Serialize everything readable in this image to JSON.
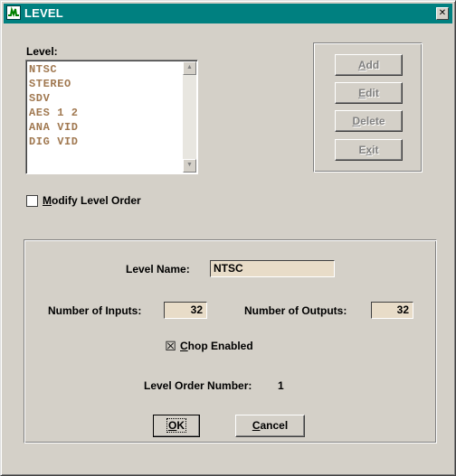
{
  "window": {
    "title": "LEVEL",
    "close_glyph": "✕",
    "app_icon": "level-app-icon"
  },
  "level_list": {
    "label": "Level:",
    "items": [
      "NTSC",
      "STEREO",
      "SDV",
      "AES 1 2",
      "ANA VID",
      "DIG VID"
    ],
    "scroll_up_glyph": "▲",
    "scroll_down_glyph": "▼"
  },
  "actions": {
    "add": {
      "first": "",
      "ul": "A",
      "rest": "dd"
    },
    "edit": {
      "first": "",
      "ul": "E",
      "rest": "dit"
    },
    "delete": {
      "first": "",
      "ul": "D",
      "rest": "elete"
    },
    "exit": {
      "first": "E",
      "ul": "x",
      "rest": "it"
    }
  },
  "modify_order": {
    "ul": "M",
    "rest": "odify Level Order",
    "checked": false
  },
  "details": {
    "level_name_label": "Level Name:",
    "level_name_value": "NTSC",
    "inputs_label": "Number of Inputs:",
    "inputs_value": "32",
    "outputs_label": "Number of Outputs:",
    "outputs_value": "32",
    "chop": {
      "ul": "C",
      "rest": "hop Enabled",
      "checked": true,
      "mark": "☒"
    },
    "order_label": "Level Order Number:",
    "order_value": "1"
  },
  "dialog_buttons": {
    "ok": {
      "ul": "O",
      "rest": "K"
    },
    "cancel": {
      "ul": "C",
      "rest": "ancel"
    }
  },
  "colors": {
    "titlebar": "#008080",
    "list_text": "#a07850",
    "field_bg": "#e8dcc8",
    "face": "#d4d0c8"
  }
}
